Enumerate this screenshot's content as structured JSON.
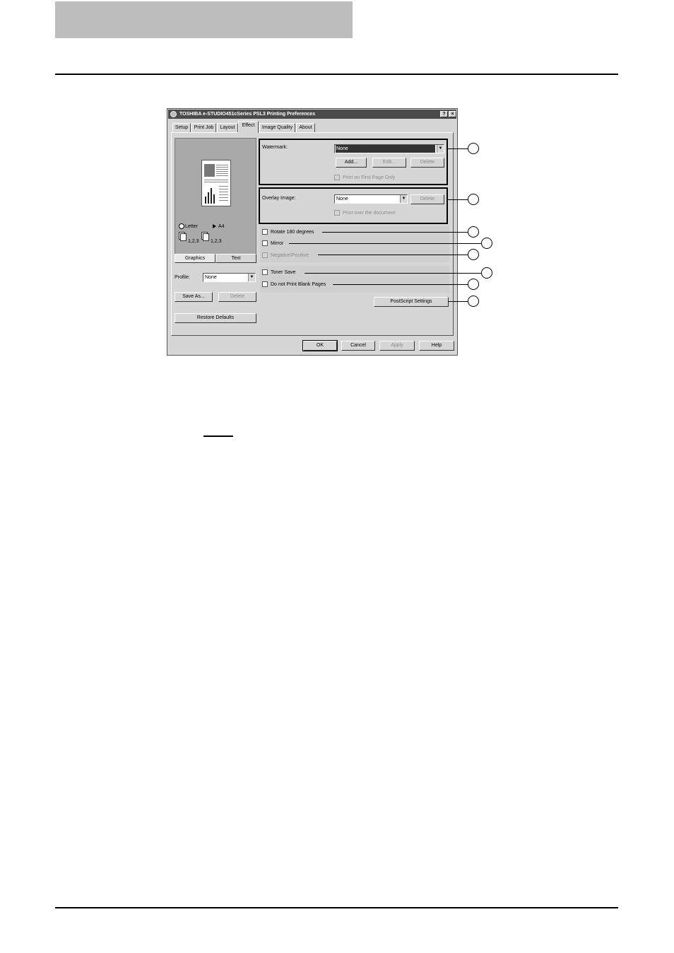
{
  "dialog": {
    "title": "TOSHIBA e-STUDIO451cSeries PSL3 Printing Preferences",
    "help_btn": "?",
    "close_btn": "×",
    "tabs": [
      "Setup",
      "Print Job",
      "Layout",
      "Effect",
      "Image Quality",
      "About"
    ],
    "active_tab": "Effect",
    "preview": {
      "paper_from": "Letter",
      "paper_to": "A4",
      "copies_a": "1,2,3",
      "copies_b": "1,2,3",
      "toggle_graphics": "Graphics",
      "toggle_text": "Text"
    },
    "profile": {
      "label": "Profile:",
      "value": "None"
    },
    "save_as": "Save As...",
    "delete_profile": "Delete",
    "restore_defaults": "Restore Defaults",
    "watermark": {
      "label": "Watermark:",
      "value": "None",
      "add": "Add...",
      "edit": "Edit...",
      "delete": "Delete",
      "first_page_only": "Print on First Page Only"
    },
    "overlay": {
      "label": "Overlay Image:",
      "value": "None",
      "delete": "Delete",
      "print_over": "Print over the document"
    },
    "options": {
      "rotate": "Rotate 180 degrees",
      "mirror": "Mirror",
      "negative": "Negative/Positive",
      "toner_save": "Toner Save",
      "no_blank": "Do not Print Blank Pages"
    },
    "postscript_settings": "PostScript Settings",
    "ok": "OK",
    "cancel": "Cancel",
    "apply": "Apply",
    "help": "Help"
  }
}
